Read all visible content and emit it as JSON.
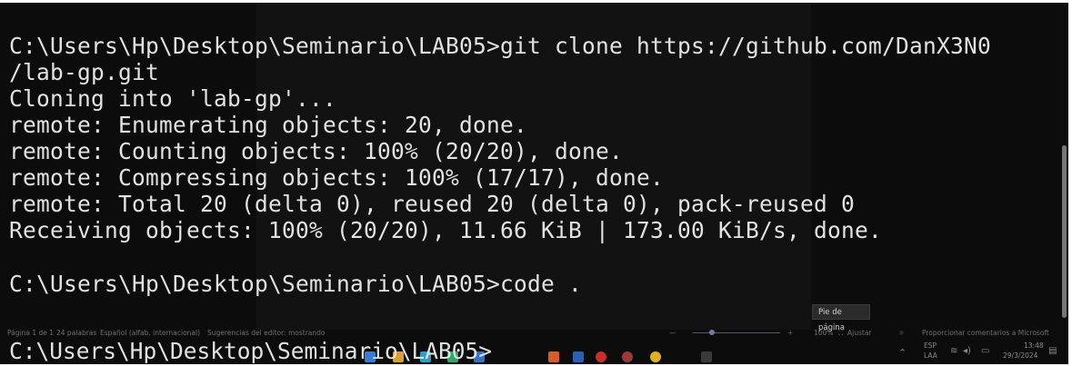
{
  "terminal": {
    "lines": [
      "C:\\Users\\Hp\\Desktop\\Seminario\\LAB05>git clone https://github.com/DanX3N0",
      "/lab-gp.git",
      "Cloning into 'lab-gp'...",
      "remote: Enumerating objects: 20, done.",
      "remote: Counting objects: 100% (20/20), done.",
      "remote: Compressing objects: 100% (17/17), done.",
      "remote: Total 20 (delta 0), reused 20 (delta 0), pack-reused 0",
      "Receiving objects: 100% (20/20), 11.66 KiB | 173.00 KiB/s, done.",
      "",
      "C:\\Users\\Hp\\Desktop\\Seminario\\LAB05>code ."
    ],
    "prompt_line": "C:\\Users\\Hp\\Desktop\\Seminario\\LAB05>"
  },
  "tooltip": {
    "text": "Pie de página"
  },
  "word_statusbar": {
    "page": "Página 1 de 1",
    "words": "24 palabras",
    "language": "Español (alfab. internacional)",
    "editor": "Sugerencias del editor: mostrando",
    "zoom_minus": "—",
    "zoom_plus": "+",
    "zoom": "100%",
    "fit": "Ajustar",
    "feedback": "Proporcionar comentarios a Microsoft"
  },
  "tray": {
    "language_top": "ESP",
    "language_bottom": "LAA",
    "time": "13:48",
    "date": "29/3/2024"
  },
  "colors": {
    "terminal_bg": "#0c0c0c",
    "terminal_text": "#e2e2e2",
    "border": "#ffffff"
  }
}
